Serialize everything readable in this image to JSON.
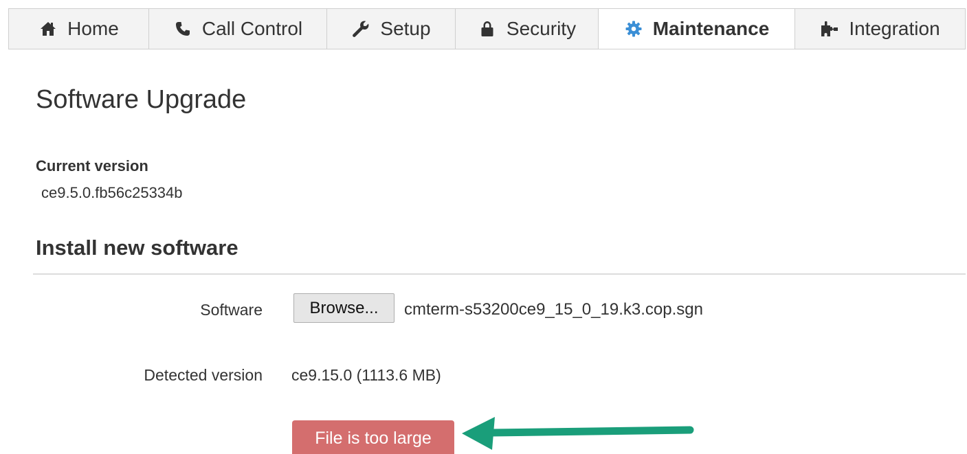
{
  "tabs": [
    {
      "label": "Home",
      "icon": "home-icon"
    },
    {
      "label": "Call Control",
      "icon": "phone-icon"
    },
    {
      "label": "Setup",
      "icon": "wrench-icon"
    },
    {
      "label": "Security",
      "icon": "lock-icon"
    },
    {
      "label": "Maintenance",
      "icon": "gear-icon",
      "active": true
    },
    {
      "label": "Integration",
      "icon": "puzzle-icon"
    }
  ],
  "page": {
    "title": "Software Upgrade",
    "current_version_label": "Current version",
    "current_version_value": "ce9.5.0.fb56c25334b",
    "section_title": "Install new software"
  },
  "form": {
    "software_label": "Software",
    "browse_label": "Browse...",
    "file_name": "cmterm-s53200ce9_15_0_19.k3.cop.sgn",
    "detected_label": "Detected version",
    "detected_value": "ce9.15.0 (1113.6 MB)",
    "error_text": "File is too large"
  },
  "colors": {
    "accent_gear": "#3b8fd6",
    "error_bg": "#d46e6e",
    "arrow": "#1a9e7a"
  }
}
